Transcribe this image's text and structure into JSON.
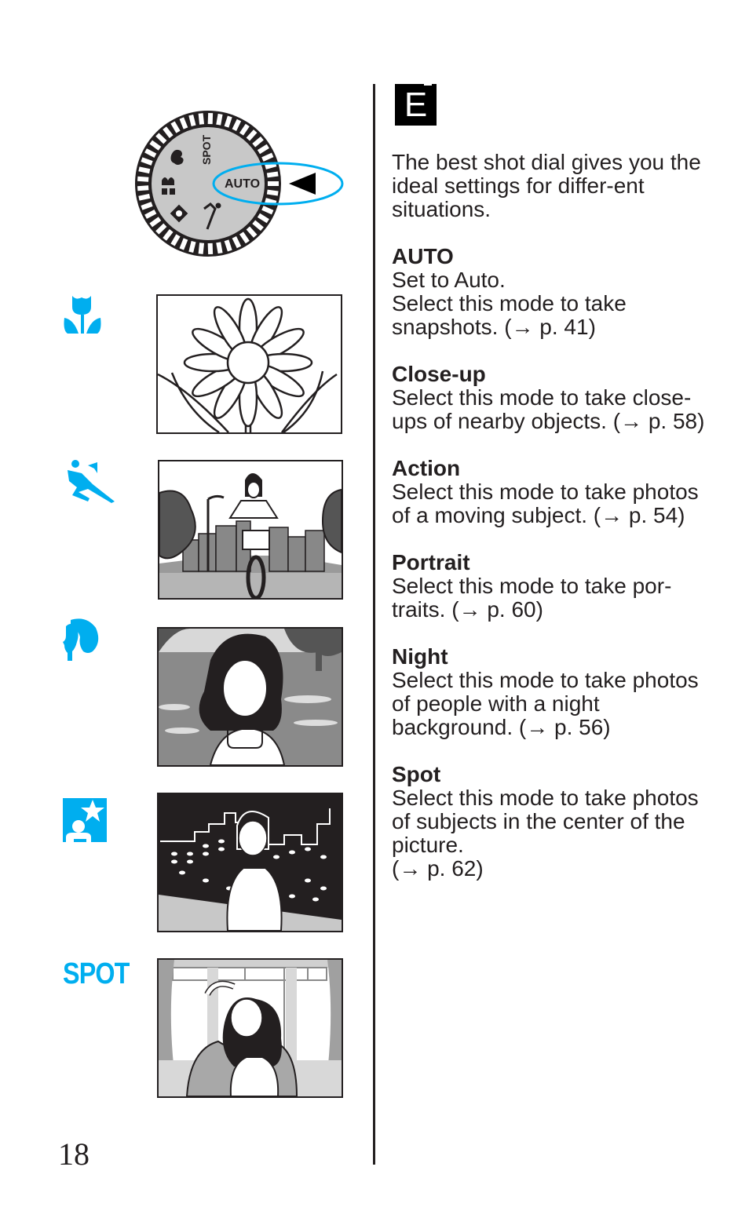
{
  "page": {
    "section_tab": "E",
    "page_number": "18",
    "accent_color": "#00aeef"
  },
  "dial": {
    "selected_label": "AUTO",
    "spot_label": "SPOT",
    "icons": [
      "portrait-icon",
      "closeup-icon",
      "night-icon",
      "action-icon"
    ]
  },
  "intro": "The best shot dial gives you the ideal settings for differ-ent situations.",
  "modes": [
    {
      "id": "auto",
      "title": "AUTO",
      "lines": [
        "Set to Auto.",
        "Select this mode to take snapshots. (→ p. 41)"
      ]
    },
    {
      "id": "close-up",
      "title": "Close-up",
      "lines": [
        "Select this mode to take close-ups of nearby objects. (→ p. 58)"
      ]
    },
    {
      "id": "action",
      "title": "Action",
      "lines": [
        "Select this mode to take photos of a moving subject. (→ p. 54)"
      ]
    },
    {
      "id": "portrait",
      "title": "Portrait",
      "lines": [
        "Select this mode to take por-traits. (→ p. 60)"
      ]
    },
    {
      "id": "night",
      "title": "Night",
      "lines": [
        "Select this mode to take photos of people with a night background. (→ p. 56)"
      ]
    },
    {
      "id": "spot",
      "title": "Spot",
      "lines": [
        "Select this mode to take photos of subjects in the center of the picture.",
        "(→ p. 62)"
      ]
    }
  ],
  "side_icons": {
    "spot_text": "SPOT"
  }
}
